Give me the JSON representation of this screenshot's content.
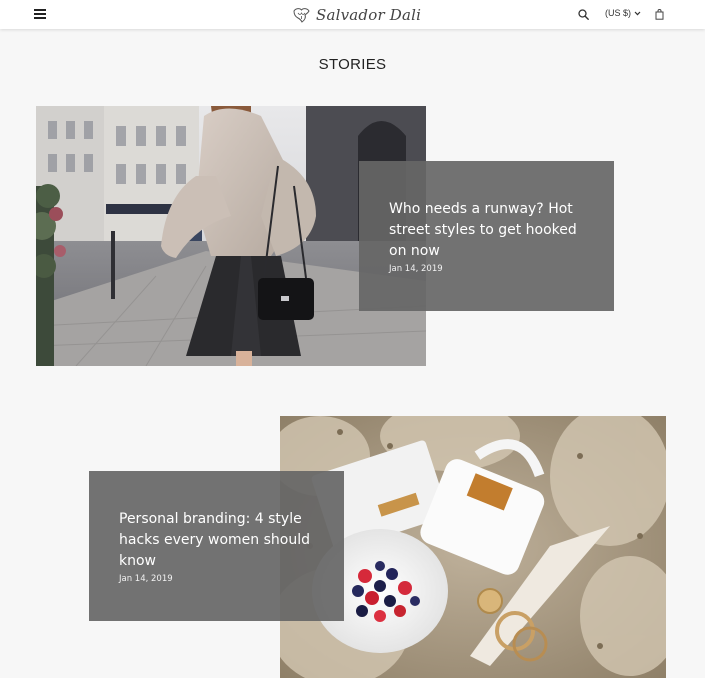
{
  "header": {
    "brand": "Salvador Dali",
    "currency_label": "(US $)",
    "icons": [
      "menu-icon",
      "logo-mark-icon",
      "search-icon",
      "chevron-down-icon",
      "cart-icon"
    ]
  },
  "page": {
    "title": "STORIES"
  },
  "stories": [
    {
      "title": "Who needs a runway? Hot street styles to get hooked on now",
      "date": "Jan 14, 2019"
    },
    {
      "title": "Personal branding: 4 style hacks every women should know",
      "date": "Jan 14, 2019"
    }
  ],
  "colors": {
    "background": "#f7f7f7",
    "header": "#ffffff",
    "card_overlay": "#666666",
    "text_dark": "#222222"
  }
}
